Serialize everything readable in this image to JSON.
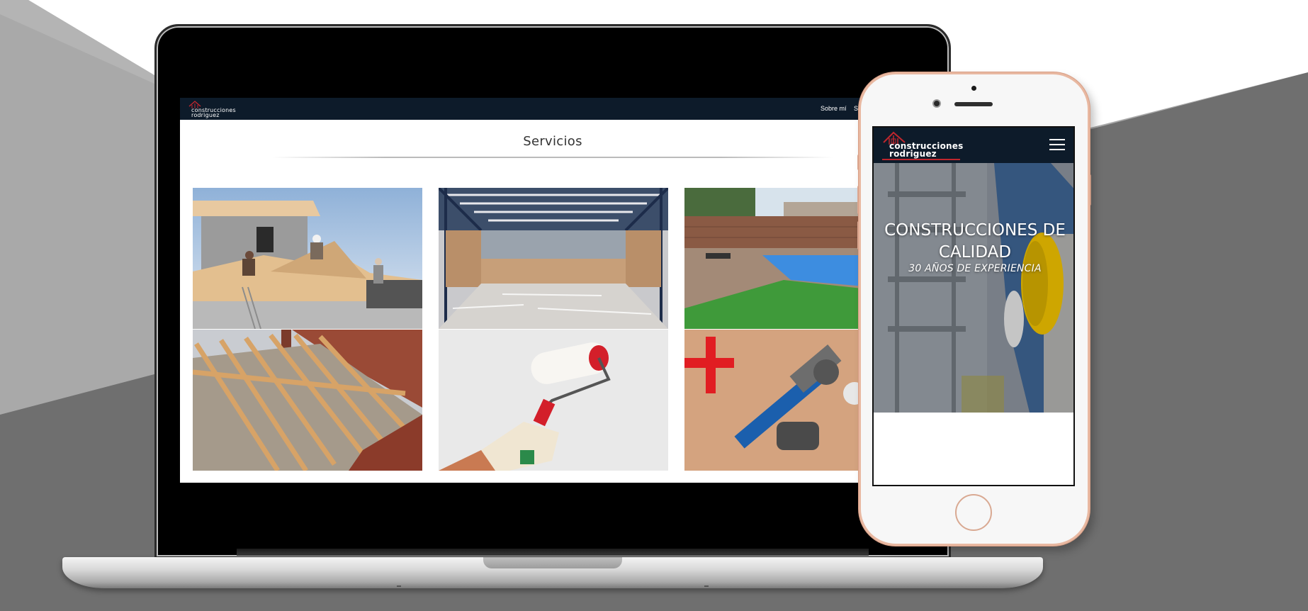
{
  "desktop": {
    "logo": {
      "line1": "construcciones",
      "line2": "rodriguez"
    },
    "nav": {
      "about": "Sobre mí",
      "services_partial": "Se"
    },
    "section_title": "Servicios",
    "tiles": [
      {
        "name": "roof-construction-photo"
      },
      {
        "name": "industrial-warehouse-photo"
      },
      {
        "name": "pool-deck-photo"
      },
      {
        "name": "roof-timber-frame-photo"
      },
      {
        "name": "paint-roller-photo"
      },
      {
        "name": "plumbing-tools-photo"
      }
    ]
  },
  "mobile": {
    "logo": {
      "line1": "construcciones",
      "line2": "rodriguez"
    },
    "hero_title": "CONSTRUCCIONES DE CALIDAD",
    "hero_subtitle": "30 AÑOS DE EXPERIENCIA",
    "menu_icon": "hamburger-icon"
  },
  "colors": {
    "nav_bg": "#0d1b2a",
    "brand_red": "#c0262d",
    "phone_frame": "#e8b8a1"
  }
}
